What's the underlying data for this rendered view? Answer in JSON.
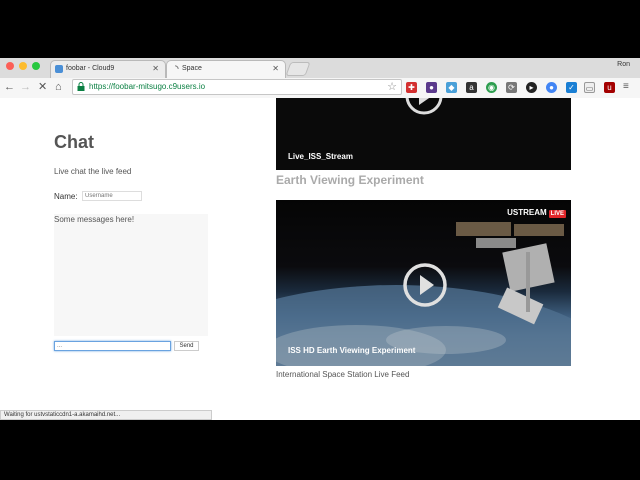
{
  "browser": {
    "tabs": [
      {
        "label": "foobar - Cloud9",
        "active": false
      },
      {
        "label": "Space",
        "active": true
      }
    ],
    "profile": "Ron",
    "url": "https://foobar-mitsugo.c9users.io",
    "status_text": "Waiting for ustvstaticcdn1-a.akamaihd.net..."
  },
  "chat": {
    "title": "Chat",
    "subtitle": "Live chat the live feed",
    "name_label": "Name:",
    "name_placeholder": "Username",
    "messages_text": "Some messages here!",
    "message_placeholder": "...",
    "send_label": "Send"
  },
  "videos": {
    "stream1_title": "Live_ISS_Stream",
    "section_heading": "Earth Viewing Experiment",
    "stream2_brand": "USTREAM",
    "stream2_live": "LIVE",
    "stream2_title": "ISS HD Earth Viewing Experiment",
    "caption": "International Space Station Live Feed"
  },
  "colors": {
    "accent_url": "#0b8043",
    "live_badge": "#e0262a",
    "focus_ring": "#6aa3e0"
  }
}
